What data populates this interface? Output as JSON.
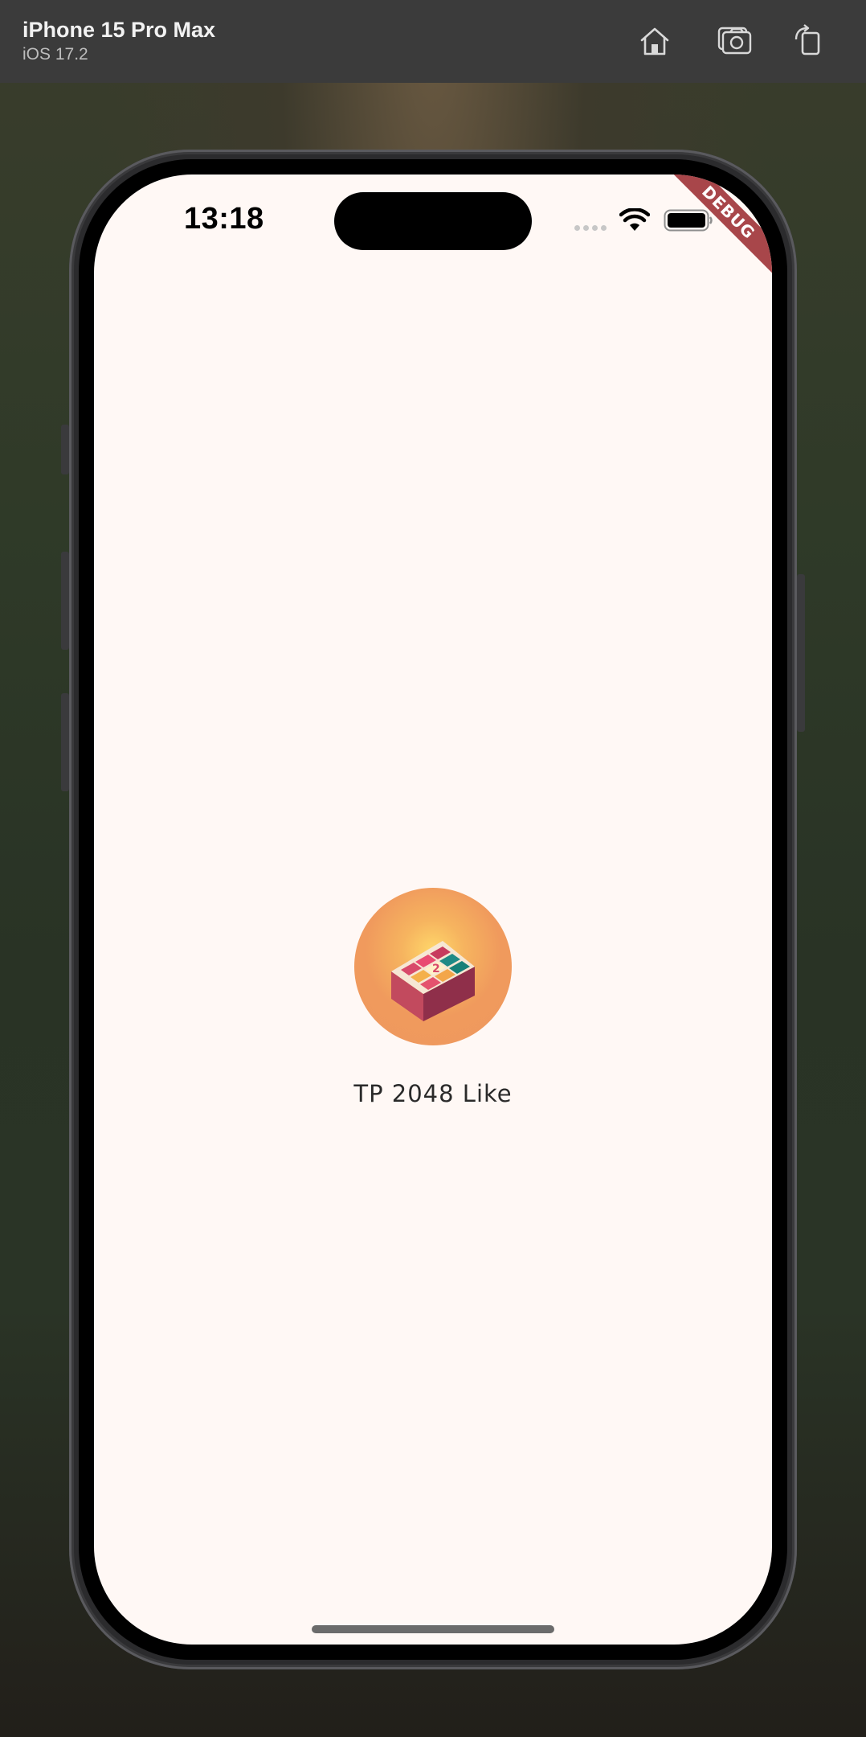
{
  "simulator": {
    "device_name": "iPhone 15 Pro Max",
    "os_version": "iOS 17.2",
    "buttons": [
      {
        "icon": "home-icon"
      },
      {
        "icon": "screenshot-camera-icon"
      },
      {
        "icon": "rotate-icon"
      }
    ]
  },
  "status_bar": {
    "time": "13:18",
    "icons": [
      "signal-dots-icon",
      "wifi-icon",
      "battery-icon"
    ]
  },
  "debug_banner": "DEBUG",
  "splash": {
    "logo_icon": "app-logo-icon",
    "app_name": "TP 2048 Like"
  },
  "colors": {
    "screen_background": "#fff8f5",
    "logo_background": "#ee985e",
    "debug_banner": "#a8464a",
    "simulator_bar": "#3b3b3b"
  }
}
